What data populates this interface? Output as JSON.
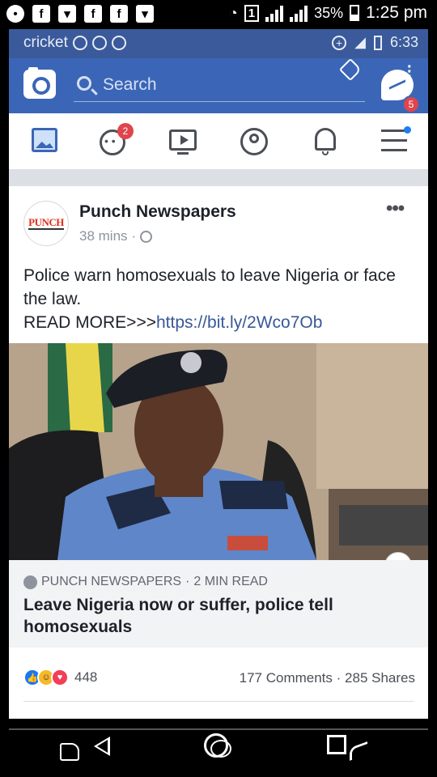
{
  "outer_status": {
    "battery": "35%",
    "time": "1:25 pm",
    "sim_label": "1"
  },
  "inner_status": {
    "carrier": "cricket",
    "time": "6:33"
  },
  "header": {
    "search_placeholder": "Search",
    "messenger_badge": "5",
    "accent_color": "#3b66b7"
  },
  "tabs": {
    "groups_badge": "2",
    "items": [
      "news-feed",
      "groups",
      "watch",
      "profile",
      "notifications",
      "menu"
    ]
  },
  "post": {
    "avatar_logo": "PUNCH",
    "page_name": "Punch Newspapers",
    "time_ago": "38 mins",
    "separator": "·",
    "text_line1": "Police warn homosexuals to leave Nigeria or face the law.",
    "text_line2_prefix": "READ MORE>>>",
    "link_url": "https://bit.ly/2Wco7Ob",
    "link_card": {
      "source": "PUNCH NEWSPAPERS",
      "read_time": "2 MIN READ",
      "title": "Leave Nigeria now or suffer, police tell homosexuals"
    },
    "reactions_count": "448",
    "comments": "177 Comments",
    "shares": "285 Shares",
    "stats_separator": "·"
  }
}
